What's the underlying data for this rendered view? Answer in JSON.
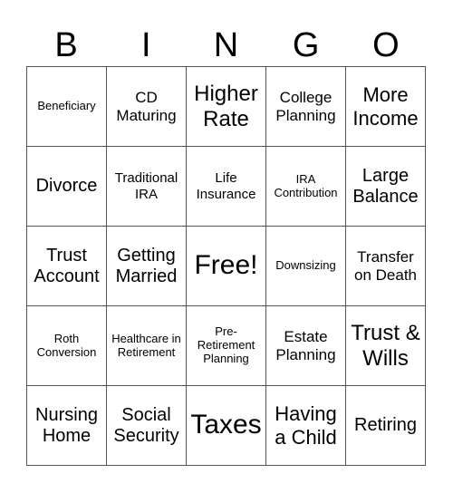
{
  "header": [
    "B",
    "I",
    "N",
    "G",
    "O"
  ],
  "cells": [
    "Beneficiary",
    "CD Maturing",
    "Higher Rate",
    "College Planning",
    "More Income",
    "Divorce",
    "Traditional IRA",
    "Life Insurance",
    "IRA Contribution",
    "Large Balance",
    "Trust Account",
    "Getting Married",
    "Free!",
    "Downsizing",
    "Transfer on Death",
    "Roth Conversion",
    "Healthcare in Retirement",
    "Pre-Retirement Planning",
    "Estate Planning",
    "Trust & Wills",
    "Nursing Home",
    "Social Security",
    "Taxes",
    "Having a Child",
    "Retiring"
  ]
}
